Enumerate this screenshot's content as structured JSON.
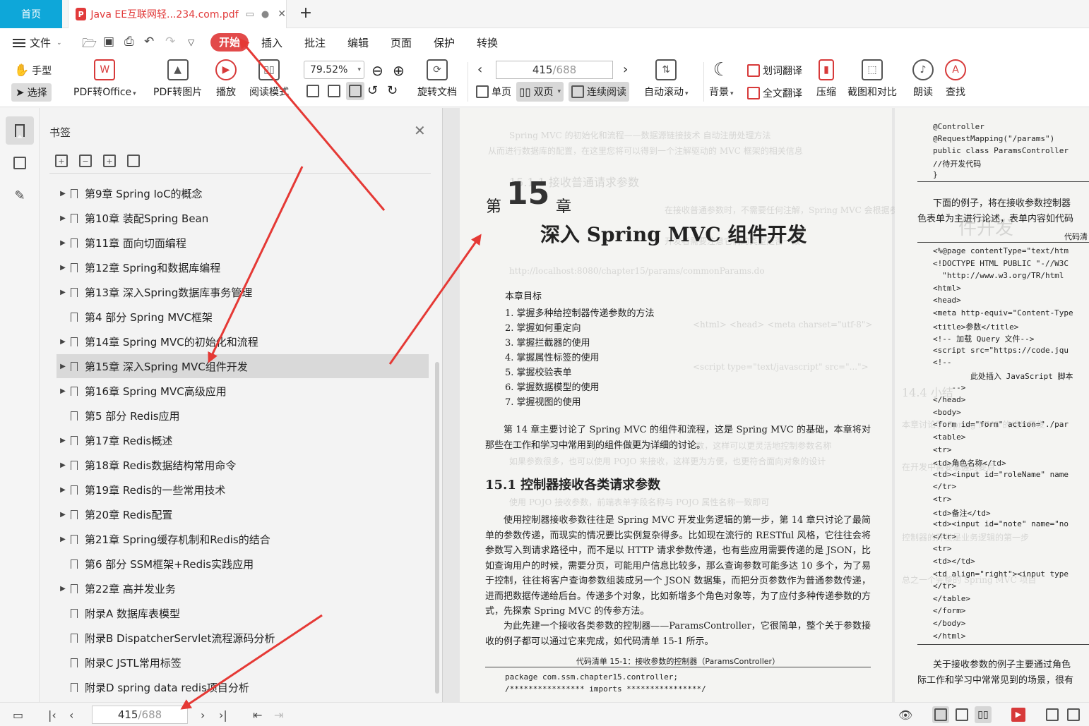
{
  "tabs": {
    "home": "首页",
    "doc_title": "Java EE互联网轻...234.com.pdf"
  },
  "menu": {
    "file": "文件",
    "start": "开始",
    "insert": "插入",
    "annotate": "批注",
    "edit": "编辑",
    "page": "页面",
    "protect": "保护",
    "convert": "转换"
  },
  "toolbar": {
    "hand": "手型",
    "select": "选择",
    "pdf_to_office": "PDF转Office",
    "pdf_to_image": "PDF转图片",
    "play": "播放",
    "read_mode": "阅读模式",
    "zoom": "79.52%",
    "rotate": "旋转文档",
    "page_current": "415",
    "page_total": "/688",
    "single": "单页",
    "double": "双页",
    "continuous": "连续阅读",
    "auto_scroll": "自动滚动",
    "background": "背景",
    "word_translate": "划词翻译",
    "full_translate": "全文翻译",
    "compress": "压缩",
    "screenshot": "截图和对比",
    "read_aloud": "朗读",
    "find": "查找"
  },
  "bookmarks": {
    "title": "书签",
    "items": [
      {
        "label": "第9章 Spring IoC的概念",
        "expandable": true
      },
      {
        "label": "第10章 装配Spring Bean",
        "expandable": true
      },
      {
        "label": "第11章 面向切面编程",
        "expandable": true
      },
      {
        "label": "第12章 Spring和数据库编程",
        "expandable": true
      },
      {
        "label": "第13章 深入Spring数据库事务管理",
        "expandable": true
      },
      {
        "label": "第4 部分 Spring MVC框架",
        "expandable": false
      },
      {
        "label": "第14章 Spring MVC的初始化和流程",
        "expandable": true
      },
      {
        "label": "第15章 深入Spring MVC组件开发",
        "expandable": true,
        "selected": true
      },
      {
        "label": "第16章 Spring MVC高级应用",
        "expandable": true
      },
      {
        "label": "第5 部分 Redis应用",
        "expandable": false
      },
      {
        "label": "第17章 Redis概述",
        "expandable": true
      },
      {
        "label": "第18章 Redis数据结构常用命令",
        "expandable": true
      },
      {
        "label": "第19章 Redis的一些常用技术",
        "expandable": true
      },
      {
        "label": "第20章 Redis配置",
        "expandable": true
      },
      {
        "label": "第21章 Spring缓存机制和Redis的结合",
        "expandable": true
      },
      {
        "label": "第6 部分 SSM框架+Redis实践应用",
        "expandable": false
      },
      {
        "label": "第22章 高并发业务",
        "expandable": true
      },
      {
        "label": "附录A 数据库表模型",
        "expandable": false
      },
      {
        "label": "附录B DispatcherServlet流程源码分析",
        "expandable": false
      },
      {
        "label": "附录C JSTL常用标签",
        "expandable": false
      },
      {
        "label": "附录D spring data redis项目分析",
        "expandable": false
      }
    ]
  },
  "page_left": {
    "chapter_prefix": "第",
    "chapter_num": "15",
    "chapter_suffix": "章",
    "chapter_title": "深入 Spring MVC 组件开发",
    "goals_title": "本章目标",
    "goals": [
      "1. 掌握多种给控制器传递参数的方法",
      "2. 掌握如何重定向",
      "3. 掌握拦截器的使用",
      "4. 掌握属性标签的使用",
      "5. 掌握校验表单",
      "6. 掌握数据模型的使用",
      "7. 掌握视图的使用"
    ],
    "intro": "第 14 章主要讨论了 Spring MVC 的组件和流程，这是 Spring MVC 的基础，本章将对那些在工作和学习中常用到的组件做更为详细的讨论。",
    "section_title": "15.1   控制器接收各类请求参数",
    "para1": "使用控制器接收参数往往是 Spring MVC 开发业务逻辑的第一步，第 14 章只讨论了最简单的参数传递，而现实的情况要比实例复杂得多。比如现在流行的 RESTful 风格，它往往会将参数写入到请求路径中，而不是以 HTTP 请求参数传递，也有些应用需要传递的是 JSON，比如查询用户的时候，需要分页，可能用户信息比较多，那么查询参数可能多达 10 多个，为了易于控制，往往将客户查询参数组装成另一个 JSON 数据集，而把分页参数作为普通参数传递，进而把数据传递给后台。传递多个对象，比如新增多个角色对象等，为了应付多种传递参数的方式，先探索 Spring MVC 的传参方法。",
    "para2": "为此先建一个接收各类参数的控制器——ParamsController，它很简单，整个关于参数接收的例子都可以通过它来完成，如代码清单 15-1 所示。",
    "listing_caption": "代码清单 15-1：接收参数的控制器（ParamsController）",
    "code": [
      "package com.ssm.chapter15.controller;",
      "/**************** imports ****************/"
    ]
  },
  "page_right": {
    "code_top": [
      "@Controller",
      "@RequestMapping(\"/params\")",
      "public class ParamsController",
      "//待开发代码",
      "}"
    ],
    "text1": "下面的例子，将在接收参数控制器",
    "text2": "色表单为主进行论述，表单内容如代码",
    "caption": "代码清",
    "code_main": [
      "<%@page contentType=\"text/htm",
      "<!DOCTYPE HTML PUBLIC \"-//W3C",
      "  \"http://www.w3.org/TR/html",
      "<html>",
      "<head>",
      "<meta http-equiv=\"Content-Type",
      "<title>参数</title>",
      "<!-- 加载 Query 文件-->",
      "<script src=\"https://code.jqu",
      "<!--",
      "        此处插入 JavaScript 脚本",
      "    -->",
      "</head>",
      "<body>",
      "<form id=\"form\" action=\"./par",
      "<table>",
      "<tr>",
      "<td>角色名称</td>",
      "<td><input id=\"roleName\" name",
      "</tr>",
      "<tr>",
      "<td>备注</td>",
      "<td><input id=\"note\" name=\"no",
      "</tr>",
      "<tr>",
      "<td></td>",
      "<td align=\"right\"><input type",
      "</tr>",
      "</table>",
      "</form>",
      "</body>",
      "</html>"
    ],
    "text3": "关于接收参数的例子主要通过角色",
    "text4": "际工作和学习中常常见到的场景，很有"
  },
  "statusbar": {
    "page_current": "415",
    "page_total": "/688"
  },
  "colors": {
    "accent": "#0ea7d9",
    "start_tab": "#e24a4a",
    "annotation_arrow": "#e53935"
  }
}
